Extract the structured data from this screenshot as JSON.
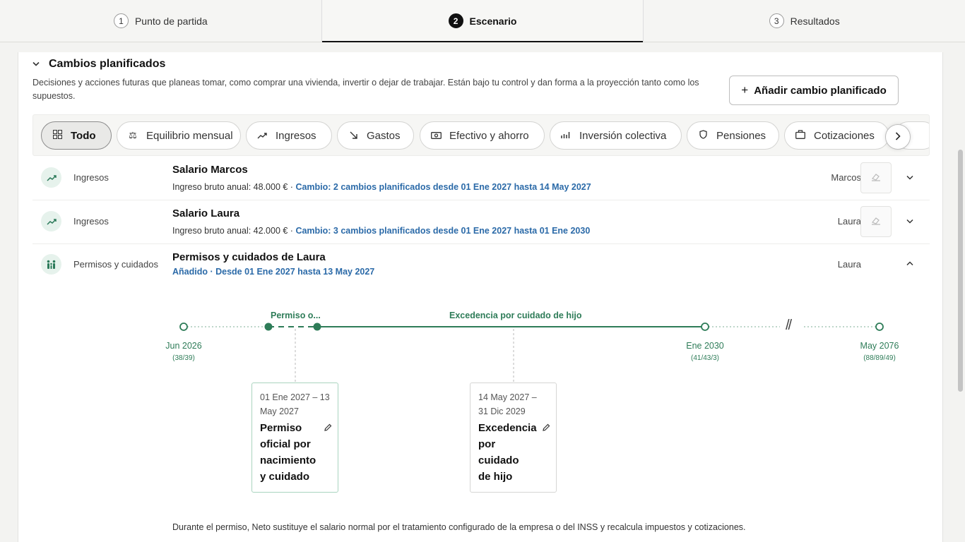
{
  "stepper": {
    "steps": [
      {
        "num": "1",
        "label": "Punto de partida"
      },
      {
        "num": "2",
        "label": "Escenario"
      },
      {
        "num": "3",
        "label": "Resultados"
      }
    ]
  },
  "section": {
    "title": "Cambios planificados",
    "description": "Decisiones y acciones futuras que planeas tomar, como comprar una vivienda, invertir o dejar de trabajar. Están bajo tu control y dan forma a la proyección tanto como los supuestos.",
    "add_button": "Añadir cambio planificado"
  },
  "filters": [
    {
      "label": "Todo",
      "icon": "grid-icon"
    },
    {
      "label": "Equilibrio mensual",
      "icon": "scale-icon"
    },
    {
      "label": "Ingresos",
      "icon": "trend-up-icon"
    },
    {
      "label": "Gastos",
      "icon": "arrow-down-right-icon"
    },
    {
      "label": "Efectivo y ahorro",
      "icon": "cash-icon"
    },
    {
      "label": "Inversión colectiva",
      "icon": "chart-icon"
    },
    {
      "label": "Pensiones",
      "icon": "shield-icon"
    },
    {
      "label": "Cotizaciones",
      "icon": "briefcase-icon"
    }
  ],
  "rows": [
    {
      "category": "Ingresos",
      "title": "Salario Marcos",
      "subtitle": "Ingreso bruto anual: 48.000 € · ",
      "change": "Cambio: 2 cambios planificados desde 01 Ene 2027 hasta 14 May 2027",
      "person": "Marcos"
    },
    {
      "category": "Ingresos",
      "title": "Salario Laura",
      "subtitle": "Ingreso bruto anual: 42.000 € · ",
      "change": "Cambio: 3 cambios planificados desde 01 Ene 2027 hasta 01 Ene 2030",
      "person": "Laura"
    },
    {
      "category": "Permisos y cuidados",
      "title": "Permisos y cuidados de Laura",
      "change": "Añadido · Desde 01 Ene 2027 hasta 13 May 2027",
      "person": "Laura"
    }
  ],
  "timeline": {
    "segment_short": "Permiso o...",
    "segment_long": "Excedencia por cuidado de hijo",
    "points": [
      {
        "date": "Jun 2026",
        "ages": "(38/39)"
      },
      {
        "date": "Ene 2030",
        "ages": "(41/43/3)"
      },
      {
        "date": "May 2076",
        "ages": "(88/89/49)"
      }
    ],
    "break_mark": "//",
    "cards": [
      {
        "dates": "01 Ene 2027 – 13 May 2027",
        "name": "Permiso oficial por nacimiento y cuidado"
      },
      {
        "dates": "14 May 2027 – 31 Dic 2029",
        "name": "Excedencia por cuidado de hijo"
      }
    ],
    "note": "Durante el permiso, Neto sustituye el salario normal por el tratamiento configurado de la empresa o del INSS y recalcula impuestos y cotizaciones."
  },
  "colors": {
    "accent_green": "#2e7c58",
    "link_blue": "#2b6aa8"
  }
}
